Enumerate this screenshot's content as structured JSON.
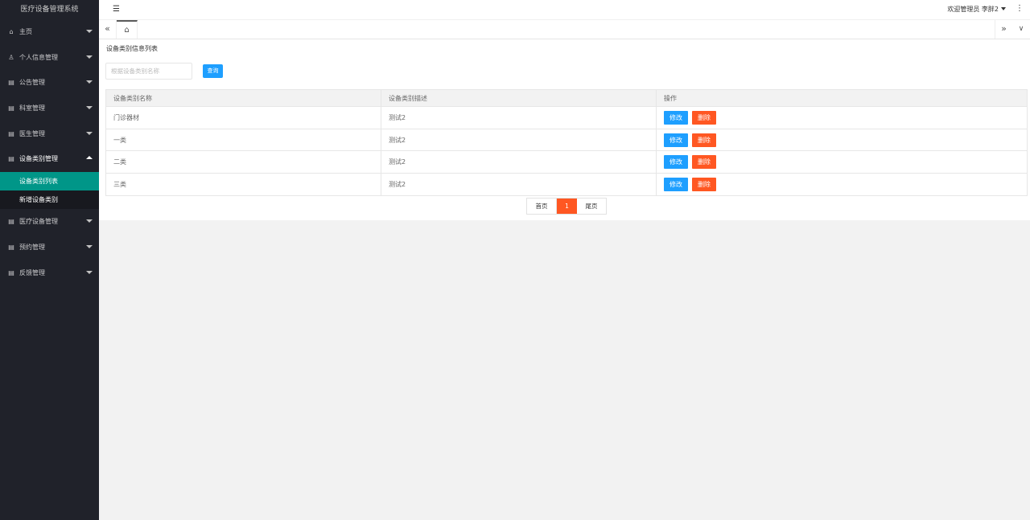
{
  "app": {
    "title": "医疗设备管理系统"
  },
  "sidebar": {
    "items": [
      {
        "label": "主页",
        "icon": "home-icon",
        "open": false
      },
      {
        "label": "个人信息管理",
        "icon": "user-icon",
        "open": false
      },
      {
        "label": "公告管理",
        "icon": "calendar-icon",
        "open": false
      },
      {
        "label": "科室管理",
        "icon": "calendar-icon",
        "open": false
      },
      {
        "label": "医生管理",
        "icon": "calendar-icon",
        "open": false
      },
      {
        "label": "设备类别管理",
        "icon": "calendar-icon",
        "open": true
      },
      {
        "label": "医疗设备管理",
        "icon": "calendar-icon",
        "open": false
      },
      {
        "label": "预约管理",
        "icon": "calendar-icon",
        "open": false
      },
      {
        "label": "反馈管理",
        "icon": "calendar-icon",
        "open": false
      }
    ],
    "subitems": [
      {
        "label": "设备类别列表",
        "active": true
      },
      {
        "label": "新增设备类别",
        "active": false
      }
    ]
  },
  "header": {
    "welcome": "欢迎管理员",
    "username": "李胖2"
  },
  "main": {
    "title": "设备类别信息列表",
    "search": {
      "placeholder": "根据设备类别名称",
      "value": ""
    },
    "search_button": "查询",
    "table": {
      "headers": [
        "设备类别名称",
        "设备类别描述",
        "操作"
      ],
      "rows": [
        {
          "name": "门诊器材",
          "desc": "测试2"
        },
        {
          "name": "一类",
          "desc": "测试2"
        },
        {
          "name": "二类",
          "desc": "测试2"
        },
        {
          "name": "三类",
          "desc": "测试2"
        }
      ],
      "edit_label": "修改",
      "delete_label": "删除"
    },
    "pager": {
      "first": "首页",
      "current": "1",
      "last": "尾页"
    }
  },
  "colors": {
    "sidebar_bg": "#20222a",
    "active_item": "#009688",
    "primary_btn": "#1e9fff",
    "danger_btn": "#ff5722"
  }
}
